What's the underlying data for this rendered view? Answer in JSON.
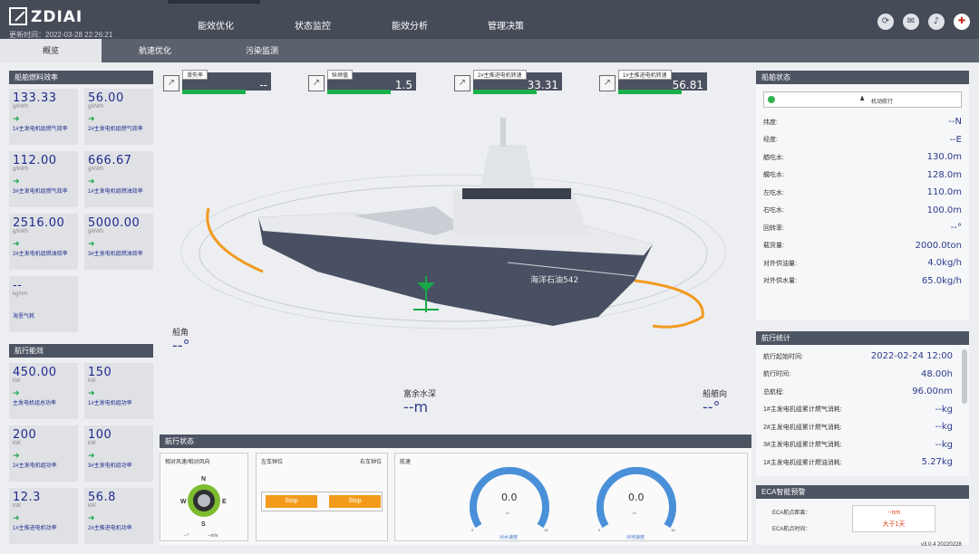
{
  "header": {
    "logo": "ZDIAI",
    "time": "更新时间：2022-03-28 22:26:21",
    "nav": [
      "能效优化",
      "状态监控",
      "能效分析",
      "管理决策"
    ],
    "icons": [
      "refresh-icon",
      "mail-icon",
      "volume-icon",
      "uk-flag-icon"
    ]
  },
  "tabs": [
    "概览",
    "航速优化",
    "污染监测"
  ],
  "left1": {
    "title": "船舶燃料效率",
    "cards": [
      {
        "value": "133.33",
        "unit": "g/kWh",
        "label": "1#主发电机组燃气效率"
      },
      {
        "value": "56.00",
        "unit": "g/kWh",
        "label": "2#主发电机组燃气效率"
      },
      {
        "value": "112.00",
        "unit": "g/kWh",
        "label": "3#主发电机组燃气效率"
      },
      {
        "value": "666.67",
        "unit": "g/kWh",
        "label": "1#主发电机组燃油效率"
      },
      {
        "value": "2516.00",
        "unit": "g/kWh",
        "label": "2#主发电机组燃油效率"
      },
      {
        "value": "5000.00",
        "unit": "g/kWh",
        "label": "3#主发电机组燃油效率"
      },
      {
        "value": "--",
        "unit": "kg/nm",
        "label": "海里气耗"
      }
    ]
  },
  "left2": {
    "title": "航行能效",
    "cards": [
      {
        "value": "450.00",
        "unit": "kW",
        "label": "主发电机组总功率"
      },
      {
        "value": "150",
        "unit": "kW",
        "label": "1#主发电机组功率"
      },
      {
        "value": "200",
        "unit": "kW",
        "label": "2#主发电机组功率"
      },
      {
        "value": "100",
        "unit": "kW",
        "label": "3#主发电机组功率"
      },
      {
        "value": "12.3",
        "unit": "kW",
        "label": "1#主推进电机功率"
      },
      {
        "value": "56.8",
        "unit": "kW",
        "label": "2#主推进电机功率"
      }
    ]
  },
  "gauges_top": [
    {
      "label": "滑失率",
      "value": "--"
    },
    {
      "label": "纵倾值",
      "value": "1.5"
    },
    {
      "label": "2#主推进电机转速",
      "value": "33.31"
    },
    {
      "label": "1#主推进电机转速",
      "value": "56.81"
    }
  ],
  "scene": {
    "heel_label": "船角",
    "heel_value": "--°",
    "depth_label": "富余水深",
    "depth_value": "--m",
    "heading_label": "船艏向",
    "heading_value": "--°",
    "ship_name": "海洋石油542"
  },
  "status": {
    "title": "船舶状态",
    "mode": "机动航行",
    "rows": [
      {
        "k": "纬度:",
        "v": "--N"
      },
      {
        "k": "经度:",
        "v": "--E"
      },
      {
        "k": "艏吃水:",
        "v": "130.0m"
      },
      {
        "k": "艉吃水:",
        "v": "128.0m"
      },
      {
        "k": "左吃水:",
        "v": "110.0m"
      },
      {
        "k": "右吃水:",
        "v": "100.0m"
      },
      {
        "k": "回转率:",
        "v": "--°"
      },
      {
        "k": "载货量:",
        "v": "2000.0ton"
      },
      {
        "k": "对外供油量:",
        "v": "4.0kg/h"
      },
      {
        "k": "对外供水量:",
        "v": "65.0kg/h"
      }
    ]
  },
  "voyage": {
    "title": "航行统计",
    "rows": [
      {
        "k": "航行起始时间:",
        "v": "2022-02-24 12:00"
      },
      {
        "k": "航行时间:",
        "v": "48.00h"
      },
      {
        "k": "总航程:",
        "v": "96.00nm"
      },
      {
        "k": "1#主发电机组累计燃气消耗:",
        "v": "--kg"
      },
      {
        "k": "2#主发电机组累计燃气消耗:",
        "v": "--kg"
      },
      {
        "k": "3#主发电机组累计燃气消耗:",
        "v": "--kg"
      },
      {
        "k": "1#主发电机组累计燃油消耗:",
        "v": "5.27kg"
      }
    ]
  },
  "eca": {
    "title": "ECA智能预警",
    "rows": [
      {
        "k": "ECA航点距离：",
        "v": "--nm"
      },
      {
        "k": "ECA航点时间：",
        "v": "大于1天"
      }
    ]
  },
  "nav_status": {
    "title": "航行状态",
    "wind": {
      "title": "相对风速/相对风向",
      "n": "N",
      "s": "S",
      "w": "W",
      "e": "E",
      "speed": "--°",
      "unit": "--m/s"
    },
    "rudder": {
      "left_title": "左车钟位",
      "right_title": "右车钟位",
      "left": "Stop",
      "right": "Stop"
    },
    "speed": {
      "title": "航速",
      "g1_value": "0.0",
      "g1_label": "对水速度",
      "g2_value": "0.0",
      "g2_label": "对地速度",
      "min": "0",
      "max": "18",
      "unit": "kn"
    }
  },
  "version": "v3.0.4 20220228"
}
